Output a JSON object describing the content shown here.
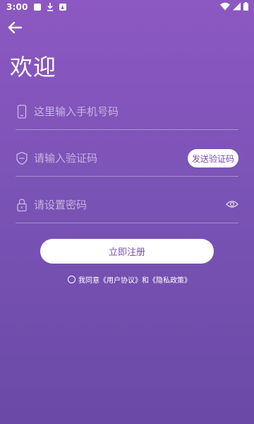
{
  "status_bar": {
    "time": "3:00",
    "icons": [
      "notification-square-icon",
      "download-icon",
      "app-notification-icon",
      "wifi-icon",
      "signal-icon",
      "battery-icon"
    ]
  },
  "header": {
    "back_icon": "back-arrow-icon",
    "title": "欢迎"
  },
  "form": {
    "phone": {
      "icon": "phone-icon",
      "placeholder": "这里输入手机号码",
      "value": ""
    },
    "code": {
      "icon": "code-badge-icon",
      "placeholder": "请输入验证码",
      "value": "",
      "send_label": "发送验证码"
    },
    "password": {
      "icon": "lock-icon",
      "placeholder": "请设置密码",
      "value": "",
      "toggle_icon": "eye-icon"
    }
  },
  "register_label": "立即注册",
  "agreement": {
    "prefix": "我同意",
    "user_agreement": "《用户协议》",
    "conjunction": "和",
    "privacy_policy": "《隐私政策》",
    "checked": false
  },
  "colors": {
    "bg_top": "#8c58c2",
    "bg_bottom": "#6a4aa6",
    "accent_text": "#7a4fb3",
    "white": "#ffffff"
  }
}
